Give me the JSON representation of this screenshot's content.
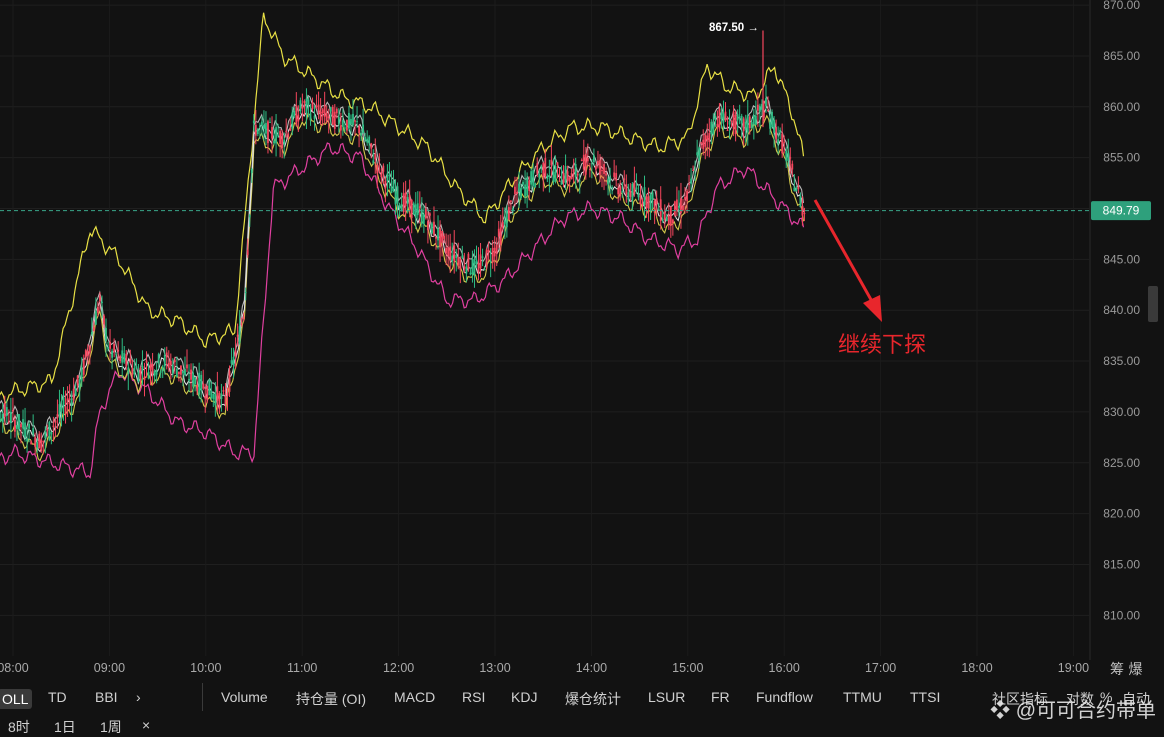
{
  "y_axis": [
    "870.00",
    "865.00",
    "860.00",
    "855.00",
    "850.00",
    "845.00",
    "840.00",
    "835.00",
    "830.00",
    "825.00",
    "820.00",
    "815.00",
    "810.00"
  ],
  "y_axis_values": [
    870,
    865,
    860,
    855,
    850,
    845,
    840,
    835,
    830,
    825,
    820,
    815,
    810
  ],
  "x_axis": [
    "08:00",
    "09:00",
    "10:00",
    "11:00",
    "12:00",
    "13:00",
    "14:00",
    "15:00",
    "16:00",
    "17:00",
    "18:00",
    "19:00"
  ],
  "axis_corner_label": "筹 爆",
  "current_price": "849.79",
  "current_price_value": 849.79,
  "high_marker": "867.50 →",
  "annotation": "继续下探",
  "colors": {
    "up": "#2ebd85",
    "down": "#f6465d",
    "boll_outer": "#e8e045",
    "lower_band": "#e040a0",
    "annotation": "#e8262c",
    "price_line": "#3aa78a"
  },
  "toolbar": {
    "boll": "OLL",
    "td": "TD",
    "bbi": "BBI",
    "more": "›",
    "volume": "Volume",
    "oi": "持仓量 (OI)",
    "macd": "MACD",
    "rsi": "RSI",
    "kdj": "KDJ",
    "liq": "爆仓统计",
    "lsur": "LSUR",
    "fr": "FR",
    "fundflow": "Fundflow",
    "ttmu": "TTMU",
    "ttsi": "TTSI",
    "community": "社区指标",
    "log": "对数",
    "percent": "%",
    "auto": "自动"
  },
  "intervals": {
    "h8": "8时",
    "d1": "1日",
    "w1": "1周",
    "close": "×"
  },
  "watermark": "@可可合约带单",
  "chart_data": {
    "type": "candlestick",
    "x_ticks": [
      "08:00",
      "09:00",
      "10:00",
      "11:00",
      "12:00",
      "13:00",
      "14:00",
      "15:00",
      "16:00",
      "17:00",
      "18:00",
      "19:00"
    ],
    "ylim": [
      806,
      870.5
    ],
    "last_price": 849.79,
    "high_label": 867.5,
    "price_path": [
      [
        7.6,
        829
      ],
      [
        7.9,
        830
      ],
      [
        8.3,
        827
      ],
      [
        8.7,
        833
      ],
      [
        8.9,
        841
      ],
      [
        9.0,
        836
      ],
      [
        9.3,
        834
      ],
      [
        9.6,
        835
      ],
      [
        9.9,
        833
      ],
      [
        10.2,
        831
      ],
      [
        10.4,
        840
      ],
      [
        10.5,
        858
      ],
      [
        10.8,
        857
      ],
      [
        11.0,
        860
      ],
      [
        11.3,
        859
      ],
      [
        11.6,
        858
      ],
      [
        11.8,
        854
      ],
      [
        12.0,
        851
      ],
      [
        12.3,
        849
      ],
      [
        12.5,
        846
      ],
      [
        12.8,
        844
      ],
      [
        13.0,
        846
      ],
      [
        13.2,
        851
      ],
      [
        13.5,
        854
      ],
      [
        13.8,
        853
      ],
      [
        14.0,
        855
      ],
      [
        14.3,
        852
      ],
      [
        14.6,
        851
      ],
      [
        14.8,
        849
      ],
      [
        15.0,
        851
      ],
      [
        15.1,
        855
      ],
      [
        15.3,
        859
      ],
      [
        15.6,
        858
      ],
      [
        15.8,
        860
      ],
      [
        16.0,
        856
      ],
      [
        16.2,
        849.79
      ]
    ],
    "upper_band": [
      [
        7.6,
        830
      ],
      [
        8.0,
        832
      ],
      [
        8.4,
        833
      ],
      [
        8.8,
        848
      ],
      [
        9.1,
        845
      ],
      [
        9.4,
        840
      ],
      [
        9.7,
        839
      ],
      [
        10.0,
        837
      ],
      [
        10.3,
        838
      ],
      [
        10.6,
        869
      ],
      [
        10.8,
        865
      ],
      [
        11.1,
        863
      ],
      [
        11.4,
        861
      ],
      [
        11.7,
        860
      ],
      [
        12.0,
        858
      ],
      [
        12.3,
        856
      ],
      [
        12.6,
        852
      ],
      [
        12.9,
        849
      ],
      [
        13.2,
        853
      ],
      [
        13.5,
        856
      ],
      [
        13.8,
        858
      ],
      [
        14.1,
        858
      ],
      [
        14.4,
        857
      ],
      [
        14.7,
        856
      ],
      [
        15.0,
        857
      ],
      [
        15.2,
        864
      ],
      [
        15.4,
        862
      ],
      [
        15.7,
        861
      ],
      [
        15.9,
        864
      ],
      [
        16.1,
        859
      ],
      [
        16.2,
        855
      ]
    ],
    "lower_band": [
      [
        7.6,
        824
      ],
      [
        8.0,
        826
      ],
      [
        8.4,
        825
      ],
      [
        8.8,
        824
      ],
      [
        8.9,
        830
      ],
      [
        9.1,
        834
      ],
      [
        9.4,
        832
      ],
      [
        9.7,
        829
      ],
      [
        10.0,
        828
      ],
      [
        10.3,
        826
      ],
      [
        10.5,
        826
      ],
      [
        10.7,
        852
      ],
      [
        11.0,
        854
      ],
      [
        11.3,
        856
      ],
      [
        11.6,
        855
      ],
      [
        11.9,
        850
      ],
      [
        12.2,
        846
      ],
      [
        12.5,
        841
      ],
      [
        12.8,
        841
      ],
      [
        13.1,
        843
      ],
      [
        13.4,
        846
      ],
      [
        13.7,
        849
      ],
      [
        14.0,
        850
      ],
      [
        14.3,
        849
      ],
      [
        14.6,
        847
      ],
      [
        14.9,
        846
      ],
      [
        15.1,
        847
      ],
      [
        15.3,
        852
      ],
      [
        15.6,
        854
      ],
      [
        15.9,
        851
      ],
      [
        16.2,
        848
      ]
    ]
  }
}
